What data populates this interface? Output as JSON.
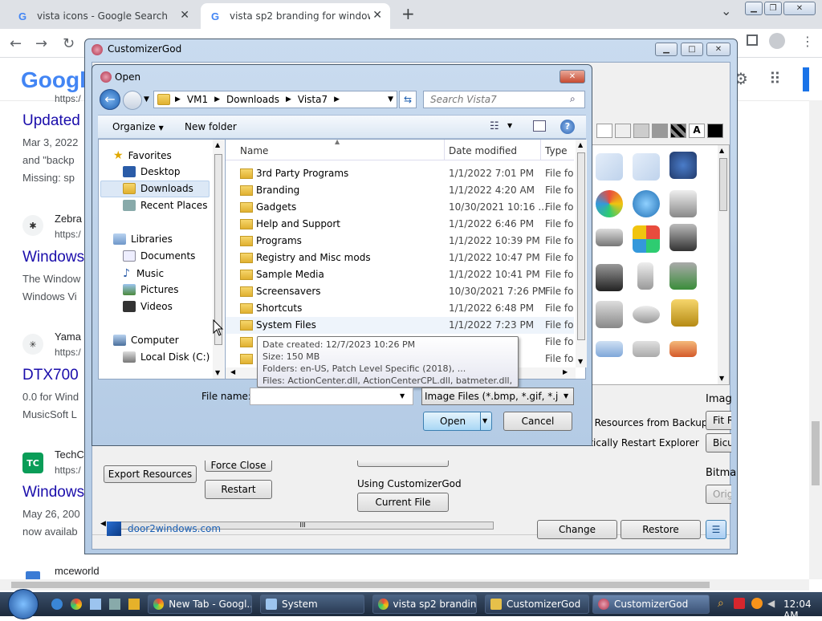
{
  "browser": {
    "tabs": [
      {
        "label": "vista icons - Google Search"
      },
      {
        "label": "vista sp2 branding for windows 7"
      }
    ],
    "new_tab": "+",
    "chevron": "⌄"
  },
  "google": {
    "logo": "Google",
    "snip_url1": "https:/",
    "result1_title": "Updated",
    "result1_line1": "Mar 3, 2022",
    "result1_line2": "and \"backp",
    "result1_line3": "Missing: sp",
    "result2_site": "Zebra",
    "result2_url": "https:/",
    "result2_title": "Windows",
    "result2_line1": "The Window",
    "result2_line2": "Windows Vi",
    "result3_site": "Yama",
    "result3_url": "https:/",
    "result3_title": "DTX700",
    "result3_line1": "0.0 for Wind",
    "result3_line2": "MusicSoft L",
    "result4_site": "TechC",
    "result4_url": "https:/",
    "result4_title": "Windows",
    "result4_line1": "May 26, 200",
    "result4_line2": "now availab",
    "bottom_site": "mceworld",
    "tc_badge": "TC"
  },
  "customizer": {
    "title": "CustomizerGod",
    "export_btn": "Export Resources",
    "force_close_btn": "Force Close",
    "restart_btn": "Restart",
    "using_label": "Using CustomizerGod",
    "current_file_btn": "Current File",
    "restore_backup_label": "w Resources from Backup",
    "auto_restart_label": "atically Restart Explorer",
    "image_label": "Imag",
    "fit_btn": "Fit R",
    "bicubic_btn": "Bicu",
    "bitmap_label": "Bitma",
    "orig_btn": "Orig",
    "website": "door2windows.com",
    "change_btn": "Change",
    "restore_btn": "Restore",
    "menu_btn": "☰",
    "text_icon": "A",
    "hscroll_grip": "III"
  },
  "open_dialog": {
    "title": "Open",
    "breadcrumb": [
      "VM1",
      "Downloads",
      "Vista7"
    ],
    "search_placeholder": "Search Vista7",
    "organize": "Organize",
    "new_folder": "New folder",
    "nav": {
      "favorites": "Favorites",
      "desktop": "Desktop",
      "downloads": "Downloads",
      "recent": "Recent Places",
      "libraries": "Libraries",
      "documents": "Documents",
      "music": "Music",
      "pictures": "Pictures",
      "videos": "Videos",
      "computer": "Computer",
      "local_disk": "Local Disk (C:)"
    },
    "columns": {
      "name": "Name",
      "date": "Date modified",
      "type": "Type"
    },
    "rows": [
      {
        "name": "3rd Party Programs",
        "date": "1/1/2022 7:01 PM",
        "type": "File fol"
      },
      {
        "name": "Branding",
        "date": "1/1/2022 4:20 AM",
        "type": "File fol"
      },
      {
        "name": "Gadgets",
        "date": "10/30/2021 10:16 ...",
        "type": "File fol"
      },
      {
        "name": "Help and Support",
        "date": "1/1/2022 6:46 PM",
        "type": "File fol"
      },
      {
        "name": "Programs",
        "date": "1/1/2022 10:39 PM",
        "type": "File fol"
      },
      {
        "name": "Registry and Misc mods",
        "date": "1/1/2022 10:47 PM",
        "type": "File fol"
      },
      {
        "name": "Sample Media",
        "date": "1/1/2022 10:41 PM",
        "type": "File fol"
      },
      {
        "name": "Screensavers",
        "date": "10/30/2021 7:26 PM",
        "type": "File fol"
      },
      {
        "name": "Shortcuts",
        "date": "1/1/2022 6:48 PM",
        "type": "File fol"
      },
      {
        "name": "System Files",
        "date": "1/1/2022 7:23 PM",
        "type": "File fol"
      },
      {
        "name": "",
        "date": "M",
        "type": "File fol"
      },
      {
        "name": "",
        "date": "M",
        "type": "File fol"
      }
    ],
    "tooltip": {
      "created": "Date created: 12/7/2023 10:26 PM",
      "size": "Size: 150 MB",
      "folders": "Folders: en-US, Patch Level Specific (2018), ...",
      "files": "Files: ActionCenter.dll, ActionCenterCPL.dll, batmeter.dll, ..."
    },
    "file_name_label": "File name:",
    "file_name_value": "",
    "filter": "Image Files (*.bmp, *.gif, *.jpg,",
    "open_btn": "Open",
    "cancel_btn": "Cancel"
  },
  "taskbar": {
    "items": [
      {
        "label": "New Tab - Googl..."
      },
      {
        "label": "System"
      },
      {
        "label": "vista sp2 brandin..."
      },
      {
        "label": "CustomizerGod"
      },
      {
        "label": "CustomizerGod"
      }
    ],
    "clock": "12:04 AM"
  },
  "colors": {
    "link": "#1a0dab",
    "aero": "#b4cbe5",
    "taskbar": "#1c2a3c"
  }
}
